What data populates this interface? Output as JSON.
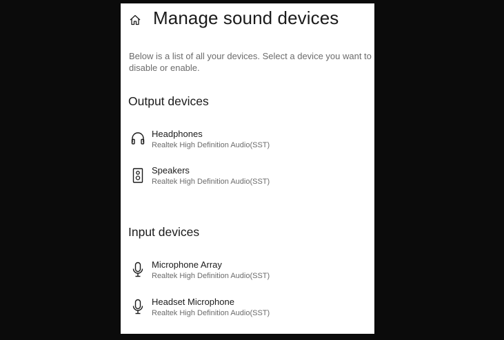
{
  "page": {
    "title": "Manage sound devices",
    "description": "Below is a list of all your devices. Select a device you want to disable or enable."
  },
  "home": {
    "icon": "home-icon"
  },
  "output_section": {
    "title": "Output devices",
    "devices": [
      {
        "name": "Headphones",
        "driver": "Realtek High Definition Audio(SST)",
        "icon": "headphones-icon"
      },
      {
        "name": "Speakers",
        "driver": "Realtek High Definition Audio(SST)",
        "icon": "speaker-icon"
      }
    ]
  },
  "input_section": {
    "title": "Input devices",
    "devices": [
      {
        "name": "Microphone Array",
        "driver": "Realtek High Definition Audio(SST)",
        "icon": "microphone-icon"
      },
      {
        "name": "Headset Microphone",
        "driver": "Realtek High Definition Audio(SST)",
        "icon": "microphone-icon"
      }
    ]
  },
  "colors": {
    "background": "#0b0b0b",
    "panel": "#ffffff",
    "text_primary": "#1a1a1a",
    "text_secondary": "#6b6b6b"
  }
}
